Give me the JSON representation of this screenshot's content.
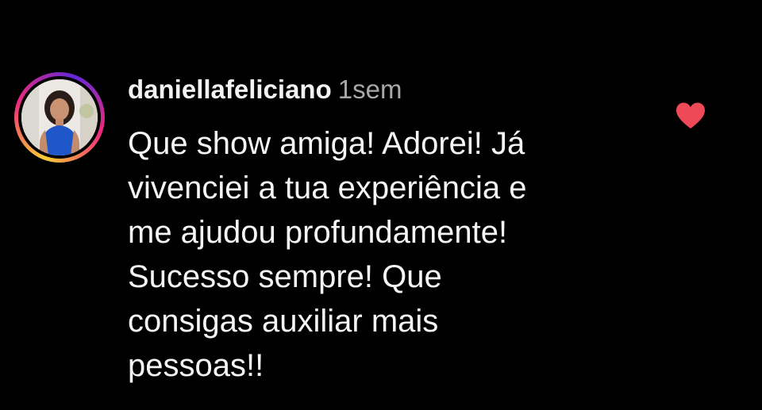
{
  "comment": {
    "username": "daniellafeliciano",
    "time_ago": "1sem",
    "text_lines": [
      "Que show amiga! Adorei! Já",
      "vivenciei a tua experiência e",
      "me ajudou profundamente!",
      "Sucesso sempre! Que",
      "consigas auxiliar mais",
      "pessoas!!"
    ],
    "liked": true
  },
  "colors": {
    "background": "#000000",
    "heart": "#ed4956",
    "time": "#a8a8a8"
  },
  "icons": {
    "like": "heart-icon"
  }
}
